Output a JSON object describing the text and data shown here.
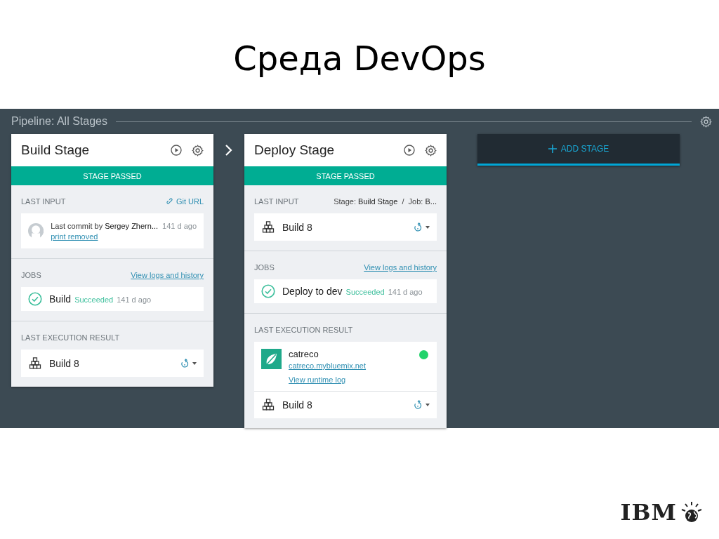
{
  "slide_title": "Среда DevOps",
  "pipeline": {
    "title": "Pipeline: All Stages",
    "stages": [
      {
        "title": "Build Stage",
        "status": {
          "kind": "passed",
          "label": "STAGE PASSED"
        },
        "sections": [
          {
            "label": "LAST INPUT",
            "link": {
              "kind": "git",
              "text": "Git URL"
            },
            "items": [
              {
                "kind": "commit",
                "text": "Last commit by **Sergey Zhern...**",
                "time": "141 d ago",
                "link": "print removed"
              }
            ]
          },
          {
            "label": "JOBS",
            "link": {
              "kind": "plain",
              "text": "View logs and history"
            },
            "items": [
              {
                "kind": "job",
                "name": "Build",
                "result": "Succeeded",
                "time": "141 d ago"
              }
            ]
          },
          {
            "label": "LAST EXECUTION RESULT",
            "items": [
              {
                "kind": "build",
                "name": "Build 8"
              }
            ]
          }
        ]
      },
      {
        "title": "Deploy Stage",
        "status": {
          "kind": "passed",
          "label": "STAGE PASSED"
        },
        "sections": [
          {
            "label": "LAST INPUT",
            "source": "Stage: **Build Stage**  /  Job: **B...**",
            "items": [
              {
                "kind": "build",
                "name": "Build 8"
              }
            ]
          },
          {
            "label": "JOBS",
            "link": {
              "kind": "plain",
              "text": "View logs and history"
            },
            "items": [
              {
                "kind": "job",
                "name": "Deploy to dev",
                "result": "Succeeded",
                "time": "141 d ago"
              }
            ]
          },
          {
            "label": "LAST EXECUTION RESULT",
            "items": [
              {
                "kind": "app",
                "name": "catreco",
                "url": "catreco.mybluemix.net",
                "log": "View runtime log",
                "color": "#22d36b"
              },
              {
                "kind": "build",
                "name": "Build 8"
              }
            ]
          }
        ]
      }
    ],
    "add_button": "ADD STAGE"
  },
  "logo": "IBM"
}
